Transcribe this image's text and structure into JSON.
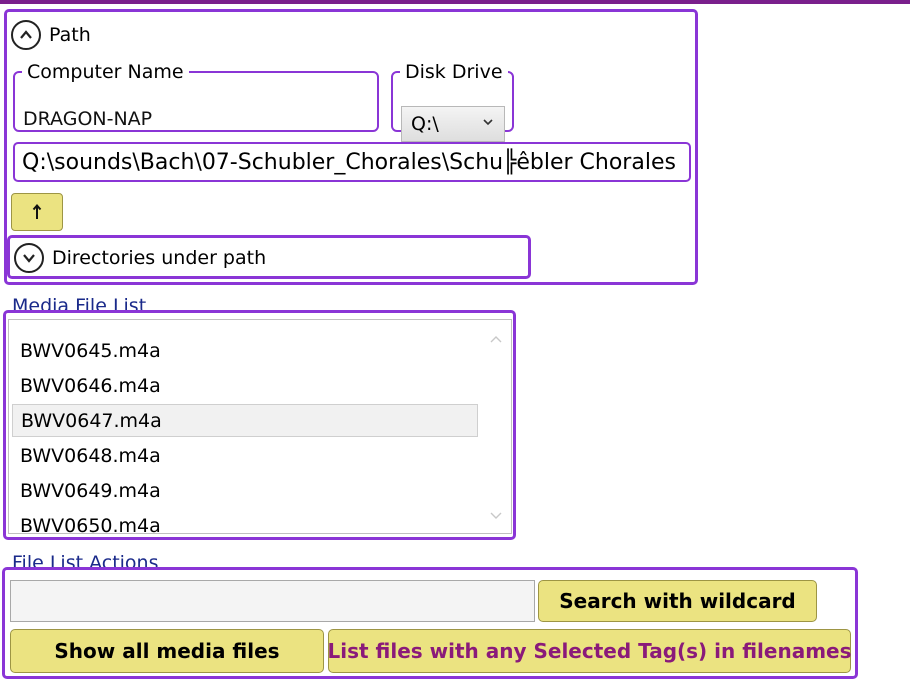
{
  "path_section": {
    "title": "Path",
    "computer_name": {
      "label": "Computer Name",
      "value": "DRAGON-NAP"
    },
    "disk_drive": {
      "label": "Disk Drive",
      "selected": "Q:\\"
    },
    "path_value": "Q:\\sounds\\Bach\\07-Schubler_Chorales\\Schu╠êbler Chorales",
    "up_icon": "up-arrow-icon"
  },
  "directories": {
    "title": "Directories under path"
  },
  "media_file_list": {
    "title": "Media File List",
    "items": [
      "BWV0645.m4a",
      "BWV0646.m4a",
      "BWV0647.m4a",
      "BWV0648.m4a",
      "BWV0649.m4a",
      "BWV0650.m4a"
    ],
    "selected_item": "BWV0647.m4a"
  },
  "file_list_actions": {
    "title": "File List Actions",
    "wildcard_value": "",
    "search_label": "Search with wildcard",
    "show_all_label": "Show all media files",
    "list_tags_label": "List files with any Selected Tag(s) in filenames"
  },
  "colors": {
    "accent_border": "#8a35d6",
    "button_fill": "#ebe381",
    "section_title": "#1a2a8a",
    "tag_button_text": "#8a1a7a"
  }
}
